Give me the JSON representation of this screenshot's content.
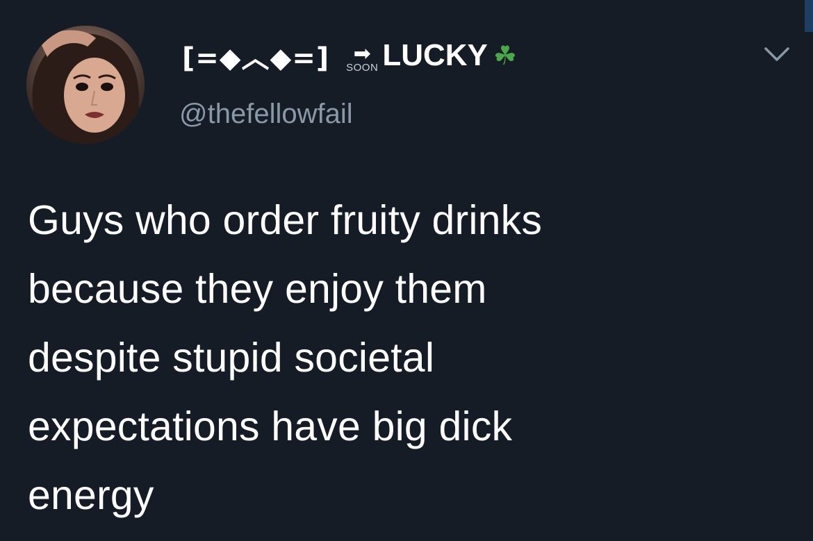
{
  "tweet": {
    "display_name_brackets": "[=◆︿◆=]",
    "arrow_glyph": "➡",
    "soon_label": "SOON",
    "display_name_suffix": "LUCKY",
    "clover_glyph": "☘",
    "handle": "@thefellowfail",
    "text_lines": [
      "Guys who order fruity drinks",
      "because they enjoy them",
      "despite stupid societal",
      "expectations have big dick",
      "energy"
    ]
  },
  "icons": {
    "menu": "chevron-down-icon",
    "clover": "shamrock-icon"
  },
  "colors": {
    "background": "#151c26",
    "text": "#ffffff",
    "handle": "#8a99a8",
    "clover": "#4aa84a"
  }
}
